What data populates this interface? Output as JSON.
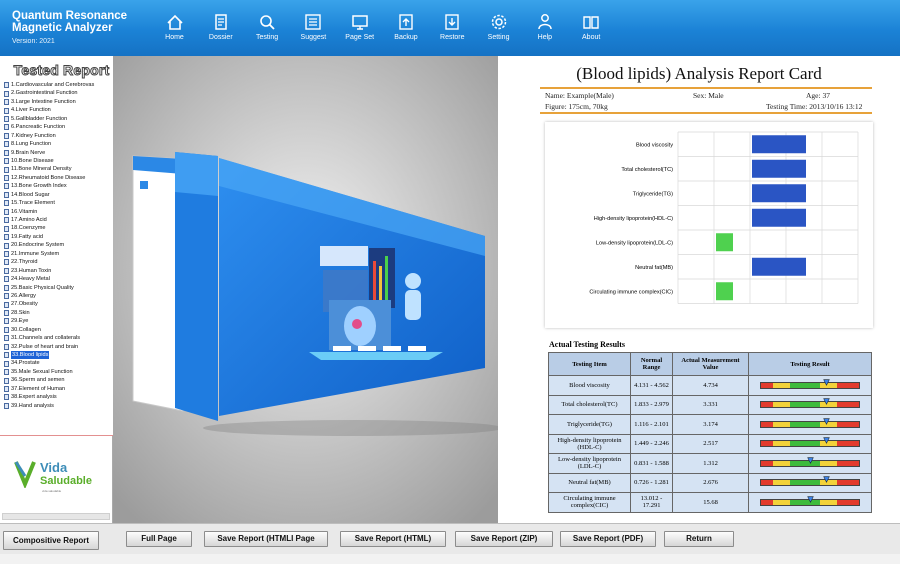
{
  "app": {
    "title_line1": "Quantum Resonance",
    "title_line2": "Magnetic Analyzer",
    "version": "Version: 2021"
  },
  "nav": [
    {
      "label": "Home",
      "icon": "home-icon"
    },
    {
      "label": "Dossier",
      "icon": "dossier-icon"
    },
    {
      "label": "Testing",
      "icon": "search-icon"
    },
    {
      "label": "Suggest",
      "icon": "list-icon"
    },
    {
      "label": "Page Set",
      "icon": "monitor-icon"
    },
    {
      "label": "Backup",
      "icon": "upload-icon"
    },
    {
      "label": "Restore",
      "icon": "download-icon"
    },
    {
      "label": "Setting",
      "icon": "gear-icon"
    },
    {
      "label": "Help",
      "icon": "person-icon"
    },
    {
      "label": "About",
      "icon": "book-icon"
    }
  ],
  "sidebar": {
    "title": "Tested Report",
    "selected_index": 32,
    "items": [
      "1.Cardiovascular and Cerebrovas",
      "2.Gastrointestinal Function",
      "3.Large Intestine Function",
      "4.Liver Function",
      "5.Gallbladder Function",
      "6.Pancreatic Function",
      "7.Kidney Function",
      "8.Lung Function",
      "9.Brain Nerve",
      "10.Bone Disease",
      "11.Bone Mineral Density",
      "12.Rheumatoid Bone Disease",
      "13.Bone Growth Index",
      "14.Blood Sugar",
      "15.Trace Element",
      "16.Vitamin",
      "17.Amino Acid",
      "18.Coenzyme",
      "19.Fatty acid",
      "20.Endocrine System",
      "21.Immune System",
      "22.Thyroid",
      "23.Human Toxin",
      "24.Heavy Metal",
      "25.Basic Physical Quality",
      "26.Allergy",
      "27.Obesity",
      "28.Skin",
      "29.Eye",
      "30.Collagen",
      "31.Channels and collaterals",
      "32.Pulse of heart and brain",
      "33.Blood lipids",
      "34.Prostate",
      "35.Male Sexual Function",
      "36.Sperm and semen",
      "37.Element of Human",
      "38.Expert analysis",
      "39.Hand analysis"
    ],
    "logo_line1": "Vida",
    "logo_line2": "Saludable",
    "logo_tagline": "vida saludable"
  },
  "report": {
    "title": "(Blood lipids) Analysis Report Card",
    "name": "Name: Example(Male)",
    "sex": "Sex: Male",
    "age": "Age: 37",
    "figure": "Figure: 175cm, 70kg",
    "testing_time": "Testing Time: 2013/10/16 13:12",
    "results_title": "Actual Testing Results",
    "headers": [
      "Testing Item",
      "Normal Range",
      "Actual Measurement Value",
      "Testing Result"
    ],
    "rows": [
      {
        "item": "Blood viscosity",
        "range": "4.131 - 4.562",
        "value": "4.734",
        "level": 0.66
      },
      {
        "item": "Total cholesterol(TC)",
        "range": "1.833 - 2.979",
        "value": "3.331",
        "level": 0.66
      },
      {
        "item": "Triglyceride(TG)",
        "range": "1.116 - 2.101",
        "value": "3.174",
        "level": 0.66
      },
      {
        "item": "High-density lipoprotein (HDL-C)",
        "range": "1.449 - 2.246",
        "value": "2.517",
        "level": 0.66
      },
      {
        "item": "Low-density lipoprotein (LDL-C)",
        "range": "0.831 - 1.588",
        "value": "1.312",
        "level": 0.5
      },
      {
        "item": "Neutral fat(MB)",
        "range": "0.726 - 1.281",
        "value": "2.676",
        "level": 0.66
      },
      {
        "item": "Circulating immune complex(CIC)",
        "range": "13.012 - 17.291",
        "value": "15.68",
        "level": 0.5
      }
    ]
  },
  "chart_data": {
    "type": "bar",
    "orientation": "horizontal",
    "categories": [
      "Blood viscosity",
      "Total cholesterol(TC)",
      "Triglyceride(TG)",
      "High-density lipoprotein(HDL-C)",
      "Low-density lipoprotein(LDL-C)",
      "Neutral fat(MB)",
      "Circulating immune complex(CIC)"
    ],
    "values": [
      3,
      3,
      3,
      3,
      1,
      3,
      1
    ],
    "colors": [
      "#2a55c4",
      "#2a55c4",
      "#2a55c4",
      "#2a55c4",
      "#4fd14f",
      "#2a55c4",
      "#4fd14f"
    ],
    "grid": true
  },
  "colors": {
    "header": "#1b82d6",
    "accent": "#e7a23a",
    "selected": "#1e63d6",
    "table_header": "#b9cde6"
  },
  "buttons": {
    "compositive": "Compositive Report",
    "full_page": "Full Page",
    "save_html_page": "Save Report (HTMLI Page",
    "save_html": "Save Report (HTML)",
    "save_zip": "Save Report (ZIP)",
    "save_pdf": "Save Report (PDF)",
    "return": "Return"
  }
}
